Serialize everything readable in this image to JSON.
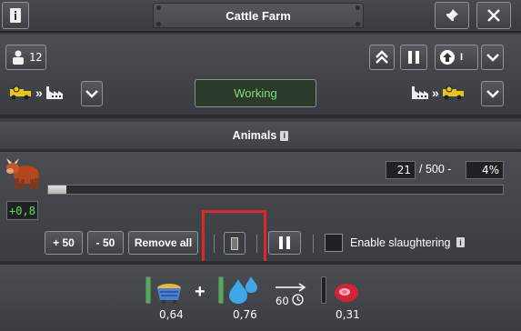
{
  "window": {
    "title": "Cattle Farm"
  },
  "header": {
    "info_icon": "info-icon",
    "pin_icon": "pin-icon",
    "close_icon": "close-icon"
  },
  "controls": {
    "workers_count": "12",
    "status": "Working",
    "upgrade_indicator": "I"
  },
  "animals": {
    "section_title": "Animals",
    "info_badge": "i",
    "count": "21",
    "capacity_separator": "/ 500 -",
    "percent": "4%",
    "growth_rate": "+0,8",
    "progress_fraction": 0.04,
    "buttons": {
      "add_50": "+ 50",
      "remove_50": "- 50",
      "remove_all": "Remove all"
    },
    "slaughter_label": "Enable slaughtering",
    "slaughter_info": "i",
    "slaughter_enabled": false
  },
  "production": {
    "inputs": [
      {
        "name": "feed-icon",
        "value": "0,64",
        "fill": 1.0
      },
      {
        "name": "water-drops-icon",
        "value": "0,76",
        "fill": 1.0
      }
    ],
    "plus": "+",
    "duration": "60",
    "output": {
      "name": "meat-icon",
      "value": "0,31",
      "fill": 0.0
    }
  },
  "colors": {
    "status_green": "#7de07a",
    "growth_green": "#5ee05a",
    "highlight_red": "#e02626",
    "bar_green": "#49b04b"
  }
}
